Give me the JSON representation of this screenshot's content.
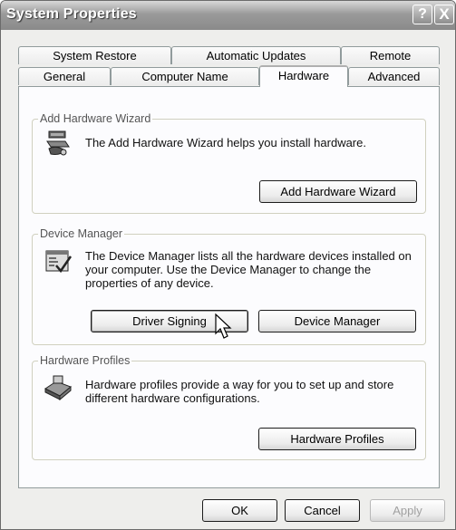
{
  "window": {
    "title": "System Properties",
    "help_label": "?",
    "close_label": "X"
  },
  "tabs_row1": [
    "System Restore",
    "Automatic Updates",
    "Remote"
  ],
  "tabs_row2": [
    "General",
    "Computer Name",
    "Hardware",
    "Advanced"
  ],
  "active_tab": "Hardware",
  "groups": {
    "add_hardware": {
      "legend": "Add Hardware Wizard",
      "text": "The Add Hardware Wizard helps you install hardware.",
      "button": "Add Hardware Wizard",
      "icon": "add-hardware-wizard-icon"
    },
    "device_manager": {
      "legend": "Device Manager",
      "text": "The Device Manager lists all the hardware devices installed on your computer. Use the Device Manager to change the properties of any device.",
      "button_driver": "Driver Signing",
      "button_device": "Device Manager",
      "icon": "device-manager-icon"
    },
    "hardware_profiles": {
      "legend": "Hardware Profiles",
      "text": "Hardware profiles provide a way for you to set up and store different hardware configurations.",
      "button": "Hardware Profiles",
      "icon": "hardware-profiles-icon"
    }
  },
  "footer": {
    "ok": "OK",
    "cancel": "Cancel",
    "apply": "Apply"
  }
}
